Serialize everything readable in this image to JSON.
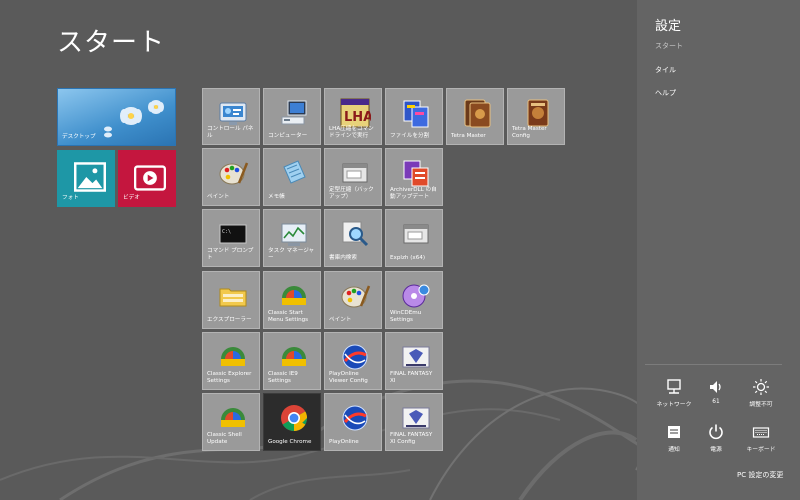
{
  "start": {
    "title": "スタート"
  },
  "group1": {
    "desktop": "デスクトップ",
    "photo": "フォト",
    "video": "ビデオ"
  },
  "tiles": {
    "control_panel": "コントロール パネル",
    "computer": "コンピューター",
    "lha_context": "LHA圧縮をコマンドラインで実行",
    "file_split": "ファイルを分割",
    "tetra_master": "Tetra Master",
    "tetra_master_config": "Tetra Master Config",
    "paint1": "ペイント",
    "notepad": "メモ帳",
    "fixed_compress": "定型圧縮（バックアップ）",
    "archiverdll_update": "ArchiverDLL の自動アップデート",
    "command_prompt": "コマンド プロンプト",
    "task_manager": "タスク マネージャー",
    "lib_search": "書庫内検索",
    "explzh_x64": "Explzh (x64)",
    "explorer": "エクスプローラー",
    "classic_start_menu": "Classic Start Menu Settings",
    "paint2": "ペイント",
    "wincdemu": "WinCDEmu Settings",
    "classic_explorer": "Classic Explorer Settings",
    "classic_ie9": "Classic IE9 Settings",
    "playonline_viewer": "PlayOnline Viewer Config",
    "ffxi": "FINAL FANTASY XI",
    "classic_shell_update": "Classic Shell Update",
    "google_chrome": "Google Chrome",
    "playonline": "PlayOnline",
    "ffxi_config": "FINAL FANTASY XI Config"
  },
  "charm": {
    "title": "設定",
    "items": [
      "スタート",
      "タイル",
      "ヘルプ"
    ],
    "quick": {
      "network": "ネットワーク",
      "volume": "61",
      "brightness": "調整不可",
      "notifications": "通知",
      "power": "電源",
      "keyboard": "キーボード"
    },
    "pc_settings": "PC 設定の変更"
  },
  "icons": {
    "control_panel": "control-panel-icon",
    "computer": "computer-icon",
    "lha": "lha-icon",
    "file_split": "file-split-icon",
    "tetra": "tetra-master-card-icon",
    "paint": "paint-palette-icon",
    "notepad": "notepad-icon",
    "window": "program-window-icon",
    "archiver": "archiver-icon",
    "cmd": "command-prompt-icon",
    "task_manager": "task-manager-icon",
    "search": "magnifier-icon",
    "folder": "folder-icon",
    "shell": "classic-shell-icon",
    "wincdemu": "wincdemu-disc-icon",
    "playonline": "playonline-globe-icon",
    "ffxi": "final-fantasy-xi-icon",
    "chrome": "chrome-icon"
  }
}
